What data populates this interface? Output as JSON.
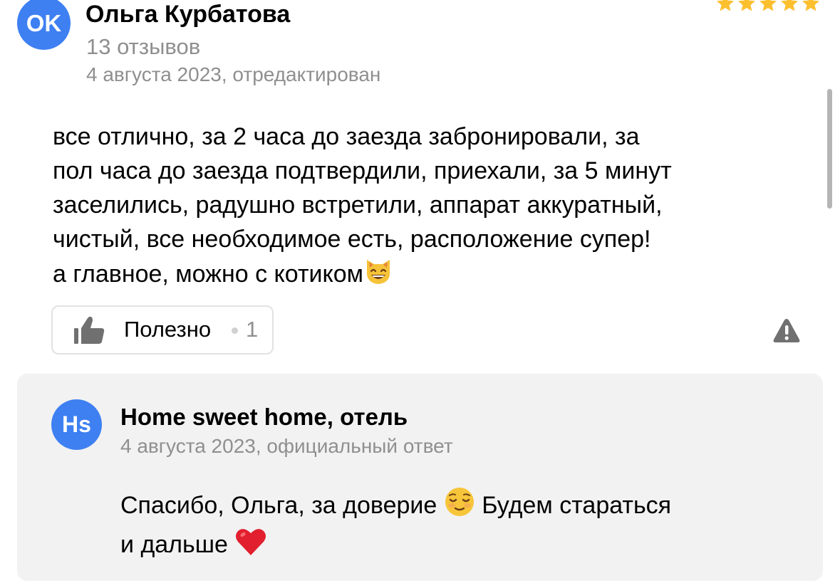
{
  "review": {
    "avatar_initials": "OK",
    "author_name": "Ольга Курбатова",
    "reviews_count": "13 отзывов",
    "date": "4 августа 2023, отредактирован",
    "rating": 5,
    "star_icon": "star-icon",
    "text_lines": [
      "все отлично, за 2 часа до заезда забронировали, за",
      "пол часа до заезда подтвердили, приехали, за 5 минут",
      "заселились, радушно встретили, аппарат аккуратный,",
      "чистый, все необходимое есть, расположение супер!",
      "а главное, можно с котиком"
    ],
    "text_end_emoji": "smiling-cat-emoji",
    "helpful": {
      "icon": "thumbs-up-icon",
      "label": "Полезно",
      "count": "1"
    },
    "report_icon": "warning-triangle-icon"
  },
  "reply": {
    "avatar_initials": "Hs",
    "author": "Home sweet home, отель",
    "meta": "4 августа 2023, официальный ответ",
    "text_lines": [
      "Спасибо, Ольга, за доверие",
      "и дальше"
    ],
    "line1_tail": "Будем стараться",
    "emoji_1": "relieved-face-emoji",
    "emoji_2": "red-heart-emoji"
  },
  "colors": {
    "avatar_blue": "#3e80f2",
    "star_gold": "#fcbf2e",
    "secondary_text": "#8f8f8f",
    "reply_background": "#f2f2f2",
    "icon_gray": "#707070",
    "scrollbar": "#b5b5b5",
    "divider_dot": "#d0d0d0"
  }
}
